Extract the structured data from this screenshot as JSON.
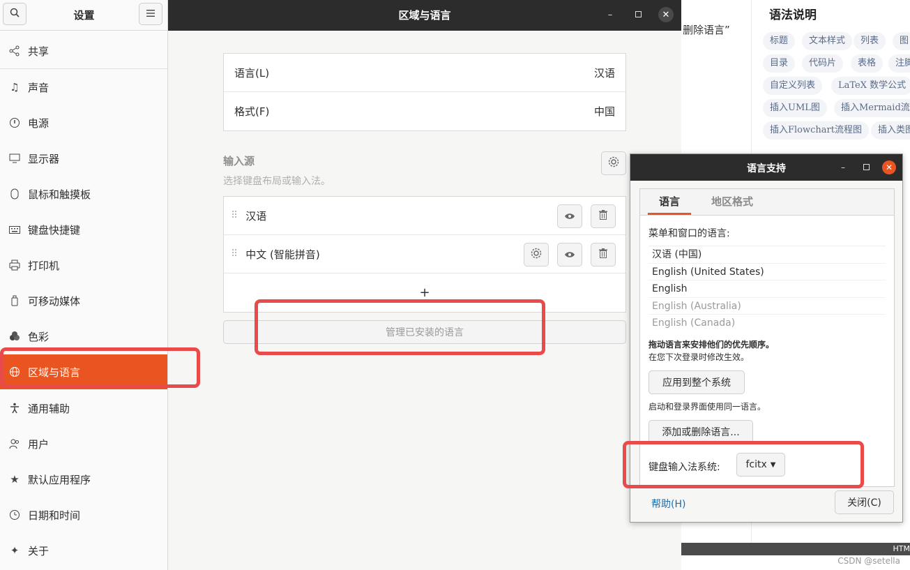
{
  "background": {
    "snippet": "删除语言”",
    "panel_title": "语法说明",
    "tags": [
      "标题",
      "文本样式",
      "列表",
      "图",
      "目录",
      "代码片",
      "表格",
      "注脚",
      "自定义列表",
      "LaTeX 数学公式",
      "插入UML图",
      "插入Mermaid流程",
      "插入Flowchart流程图",
      "插入类图"
    ],
    "footer": "HTM",
    "watermark": "CSDN @setella"
  },
  "settings": {
    "sidebar_title": "设置",
    "main_title": "区域与语言",
    "sidebar_items": [
      {
        "label": "共享",
        "icon": "share-icon"
      },
      {
        "label": "声音",
        "icon": "music-note-icon"
      },
      {
        "label": "电源",
        "icon": "power-icon"
      },
      {
        "label": "显示器",
        "icon": "display-icon"
      },
      {
        "label": "鼠标和触摸板",
        "icon": "mouse-icon"
      },
      {
        "label": "键盘快捷键",
        "icon": "keyboard-icon"
      },
      {
        "label": "打印机",
        "icon": "printer-icon"
      },
      {
        "label": "可移动媒体",
        "icon": "usb-drive-icon"
      },
      {
        "label": "色彩",
        "icon": "color-icon"
      },
      {
        "label": "区域与语言",
        "icon": "globe-icon"
      },
      {
        "label": "通用辅助",
        "icon": "accessibility-icon"
      },
      {
        "label": "用户",
        "icon": "users-icon"
      },
      {
        "label": "默认应用程序",
        "icon": "star-icon"
      },
      {
        "label": "日期和时间",
        "icon": "clock-icon"
      },
      {
        "label": "关于",
        "icon": "sparkle-icon"
      }
    ],
    "language_row": {
      "label": "语言(L)",
      "value": "汉语"
    },
    "format_row": {
      "label": "格式(F)",
      "value": "中国"
    },
    "input_sources": {
      "heading": "输入源",
      "subtitle": "选择键盘布局或输入法。",
      "items": [
        "汉语",
        "中文 (智能拼音)"
      ],
      "add_label": "+"
    },
    "manage_button": "管理已安装的语言"
  },
  "dialog": {
    "title": "语言支持",
    "tabs": [
      "语言",
      "地区格式"
    ],
    "menu_lang_label": "菜单和窗口的语言:",
    "languages": [
      "汉语 (中国)",
      "English (United States)",
      "English",
      "English (Australia)",
      "English (Canada)"
    ],
    "drag_hint": "拖动语言来安排他们的优先顺序。",
    "drag_hint_sub": "在您下次登录时修改生效。",
    "apply_button": "应用到整个系统",
    "apply_hint": "启动和登录界面使用同一语言。",
    "add_remove_button": "添加或删除语言...",
    "im_label": "键盘输入法系统:",
    "im_value": "fcitx",
    "help_link": "帮助(H)",
    "close_button": "关闭(C)"
  },
  "colors": {
    "accent": "#e95420",
    "highlight": "#e94b4b",
    "headerbar": "#2c2c2c"
  }
}
